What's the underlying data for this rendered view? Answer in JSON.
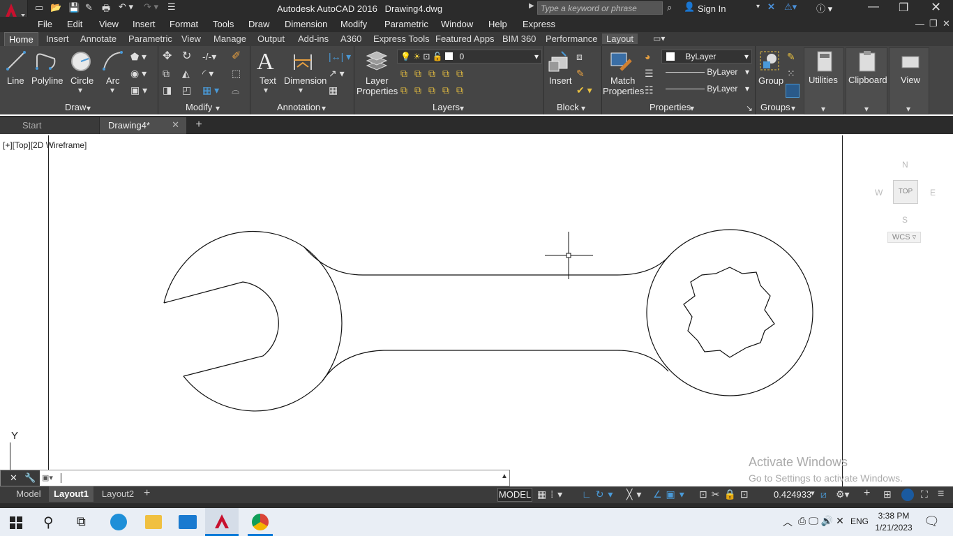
{
  "app": {
    "title": "Autodesk AutoCAD 2016",
    "filename": "Drawing4.dwg",
    "search_placeholder": "Type a keyword or phrase",
    "sign_in": "Sign In"
  },
  "menu": [
    "File",
    "Edit",
    "View",
    "Insert",
    "Format",
    "Tools",
    "Draw",
    "Dimension",
    "Modify",
    "Parametric",
    "Window",
    "Help",
    "Express"
  ],
  "ribbon_tabs": [
    "Home",
    "Insert",
    "Annotate",
    "Parametric",
    "View",
    "Manage",
    "Output",
    "Add-ins",
    "A360",
    "Express Tools",
    "Featured Apps",
    "BIM 360",
    "Performance",
    "Layout"
  ],
  "ribbon_active_tab": "Home",
  "draw": {
    "line": "Line",
    "polyline": "Polyline",
    "circle": "Circle",
    "arc": "Arc",
    "title": "Draw"
  },
  "modify": {
    "title": "Modify"
  },
  "annotation": {
    "text": "Text",
    "dimension": "Dimension",
    "title": "Annotation"
  },
  "layers": {
    "layer_properties_1": "Layer",
    "layer_properties_2": "Properties",
    "current_layer": "0",
    "title": "Layers"
  },
  "block": {
    "insert": "Insert",
    "title": "Block"
  },
  "properties": {
    "match_1": "Match",
    "match_2": "Properties",
    "color": "ByLayer",
    "linetype": "ByLayer",
    "lineweight": "ByLayer",
    "title": "Properties"
  },
  "groups": {
    "group": "Group",
    "title": "Groups"
  },
  "utilities": {
    "label": "Utilities"
  },
  "clipboard": {
    "label": "Clipboard"
  },
  "view": {
    "label": "View"
  },
  "doc_tabs": {
    "start": "Start",
    "drawing": "Drawing4*"
  },
  "viewport": {
    "label": "[+][Top][2D Wireframe]"
  },
  "viewcube": {
    "n": "N",
    "s": "S",
    "e": "E",
    "w": "W",
    "top": "TOP",
    "wcs": "WCS"
  },
  "ucs": {
    "y": "Y"
  },
  "watermark": {
    "line1": "Activate Windows",
    "line2": "Go to Settings to activate Windows."
  },
  "layout_tabs": {
    "model": "Model",
    "layout1": "Layout1",
    "layout2": "Layout2"
  },
  "status": {
    "model": "MODEL",
    "scale": "0.424933"
  },
  "taskbar": {
    "time": "3:38 PM",
    "date": "1/21/2023",
    "lang": "ENG"
  },
  "colors": {
    "dark": "#2b2b2b",
    "ribbon": "#454545",
    "accent": "#0696d7",
    "logo": "#c8102e"
  }
}
